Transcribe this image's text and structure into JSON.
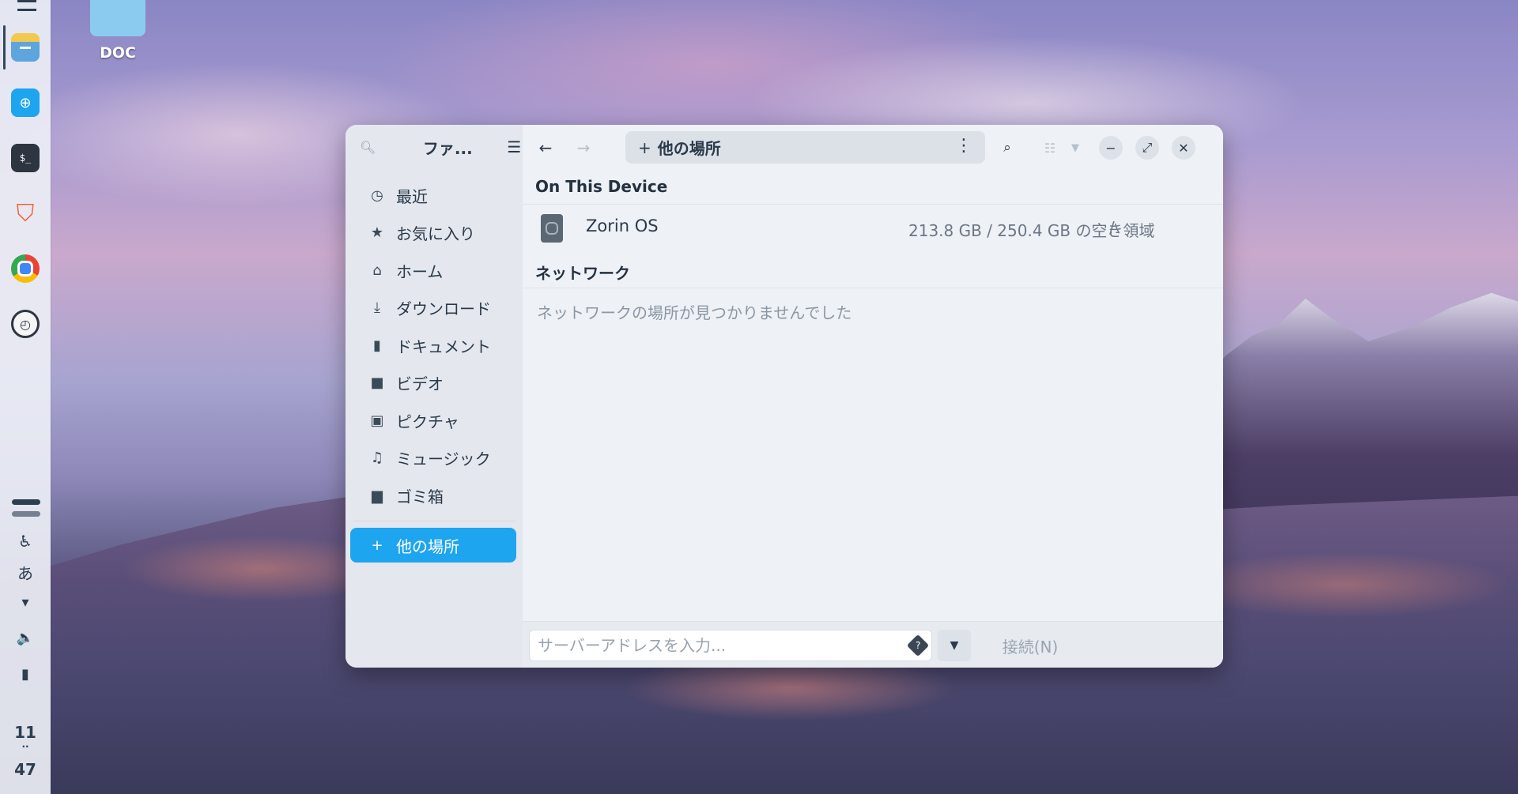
{
  "desktop": {
    "icon_label": "DOC"
  },
  "dock": {
    "apps": [
      {
        "name": "files",
        "color": "#7fb8e6"
      },
      {
        "name": "store",
        "color": "#1ea5ef"
      },
      {
        "name": "terminal",
        "color": "#2d3640"
      },
      {
        "name": "brave",
        "color": "#f26b3a"
      },
      {
        "name": "chrome",
        "color": "#34a853"
      },
      {
        "name": "clock",
        "color": "#2d3640"
      }
    ],
    "input_method": "あ",
    "clock_hour": "11",
    "clock_sep": "··",
    "clock_minute": "47"
  },
  "window": {
    "sidebar_title": "ファ...",
    "nav": [
      {
        "label": "最近",
        "icon": "clock-icon"
      },
      {
        "label": "お気に入り",
        "icon": "star-icon"
      },
      {
        "label": "ホーム",
        "icon": "home-icon"
      },
      {
        "label": "ダウンロード",
        "icon": "download-icon"
      },
      {
        "label": "ドキュメント",
        "icon": "document-icon"
      },
      {
        "label": "ビデオ",
        "icon": "video-icon"
      },
      {
        "label": "ピクチャ",
        "icon": "picture-icon"
      },
      {
        "label": "ミュージック",
        "icon": "music-icon"
      },
      {
        "label": "ゴミ箱",
        "icon": "trash-icon"
      },
      {
        "label": "他の場所",
        "icon": "plus-icon"
      }
    ],
    "path_label": "他の場所",
    "sections": {
      "device_title": "On This Device",
      "network_title": "ネットワーク"
    },
    "device": {
      "name": "Zorin OS",
      "space": "213.8 GB / 250.4 GB の空き領域",
      "mount": "/"
    },
    "network_empty": "ネットワークの場所が見つかりませんでした",
    "server_placeholder": "サーバーアドレスを入力...",
    "connect_label": "接続(N)"
  }
}
